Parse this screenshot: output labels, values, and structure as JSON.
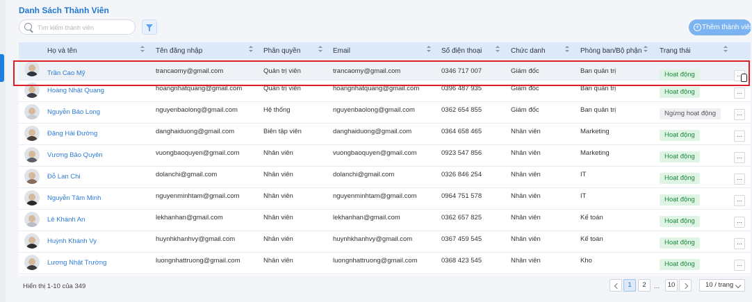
{
  "page": {
    "title": "Danh Sách Thành Viên",
    "search_placeholder": "Tìm kiếm thành viên",
    "add_button": "Thêm thành viên"
  },
  "columns": [
    "Họ và tên",
    "Tên đăng nhập",
    "Phân quyền",
    "Email",
    "Số điện thoại",
    "Chức danh",
    "Phòng ban/Bộ phận",
    "Trạng thái"
  ],
  "rows": [
    {
      "name": "Trần Cao Mỹ",
      "username": "trancaomy@gmail.com",
      "role": "Quản trị viên",
      "email": "trancaomy@gmail.com",
      "phone": "0346 717 007",
      "title": "Giám đốc",
      "dept": "Ban quản trị",
      "status": "Hoạt động"
    },
    {
      "name": "Hoàng Nhật Quang",
      "username": "hoangnhatquang@gmail.com",
      "role": "Quản trị viên",
      "email": "hoangnhatquang@gmail.com",
      "phone": "0396 487 935",
      "title": "Giám đốc",
      "dept": "Ban quản trị",
      "status": "Hoạt động"
    },
    {
      "name": "Nguyễn Bảo Long",
      "username": "nguyenbaolong@gmail.com",
      "role": "Hệ thống",
      "email": "nguyenbaolong@gmail.com",
      "phone": "0362 654 855",
      "title": "Giám đốc",
      "dept": "Ban quản trị",
      "status": "Ngừng hoạt động"
    },
    {
      "name": "Đặng Hải Đường",
      "username": "danghaiduong@gmail.com",
      "role": "Biên tập viên",
      "email": "danghaiduong@gmail.com",
      "phone": "0364 658 465",
      "title": "Nhân viên",
      "dept": "Marketing",
      "status": "Hoạt động"
    },
    {
      "name": "Vương Bảo Quyên",
      "username": "vuongbaoquyen@gmail.com",
      "role": "Nhân viên",
      "email": "vuongbaoquyen@gmail.com",
      "phone": "0923 547 856",
      "title": "Nhân viên",
      "dept": "Marketing",
      "status": "Hoạt động"
    },
    {
      "name": "Đỗ Lan Chi",
      "username": "dolanchi@gmail.com",
      "role": "Nhân viên",
      "email": "dolanchi@gmail.com",
      "phone": "0326 846 254",
      "title": "Nhân viên",
      "dept": "IT",
      "status": "Hoạt động"
    },
    {
      "name": "Nguyễn Tâm Minh",
      "username": "nguyenminhtam@gmail.com",
      "role": "Nhân viên",
      "email": "nguyenminhtam@gmail.com",
      "phone": "0964 751 578",
      "title": "Nhân viên",
      "dept": "IT",
      "status": "Hoạt động"
    },
    {
      "name": "Lê Khánh An",
      "username": "lekhanhan@gmail.com",
      "role": "Nhân viên",
      "email": "lekhanhan@gmail.com",
      "phone": "0362 657 825",
      "title": "Nhân viên",
      "dept": "Kế toán",
      "status": "Hoạt động"
    },
    {
      "name": "Huỳnh Khánh Vy",
      "username": "huynhkhanhvy@gmail.com",
      "role": "Nhân viên",
      "email": "huynhkhanhvy@gmail.com",
      "phone": "0367 459 545",
      "title": "Nhân viên",
      "dept": "Kế toán",
      "status": "Hoạt động"
    },
    {
      "name": "Lương Nhật Trường",
      "username": "luongnhattruong@gmail.com",
      "role": "Nhân viên",
      "email": "luongnhattruong@gmail.com",
      "phone": "0368 423 545",
      "title": "Nhân viên",
      "dept": "Kho",
      "status": "Hoạt động"
    }
  ],
  "more_label": "...",
  "footer": {
    "summary": "Hiển thị 1-10 của 349",
    "pages": [
      "1",
      "2",
      "10"
    ],
    "ellipsis": "...",
    "per_page": "10 / trang"
  },
  "colors": {
    "accent": "#1f78d1",
    "header_bg": "#dbe9f8",
    "active_badge": "#dff4e4",
    "highlight": "#dc1f26"
  }
}
